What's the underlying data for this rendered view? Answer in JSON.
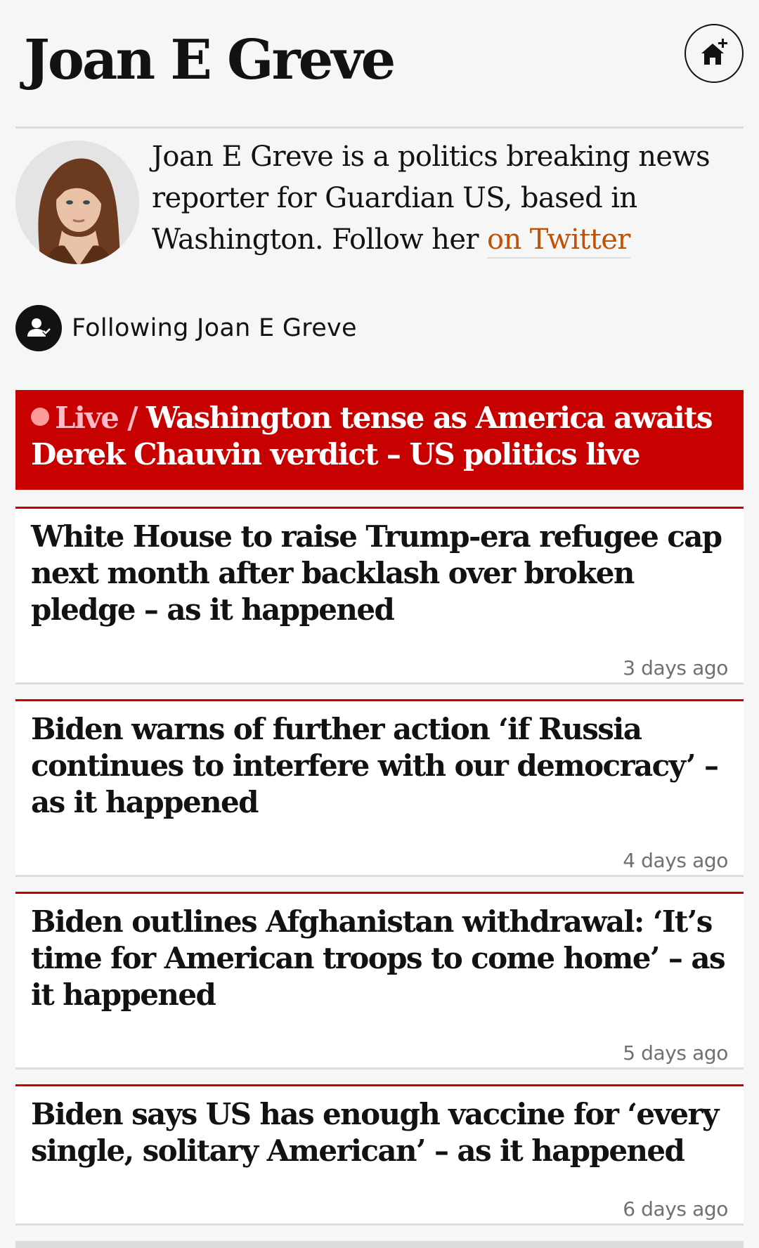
{
  "header": {
    "title": "Joan E Greve",
    "home_icon": "home-plus-icon"
  },
  "profile": {
    "avatar_icon": "avatar",
    "bio_text": "Joan E Greve is a politics breaking news reporter for Guardian US, based in Washington. Follow her ",
    "bio_link": "on Twitter"
  },
  "follow": {
    "icon": "user-following-icon",
    "label": "Following Joan E Greve"
  },
  "live_card": {
    "kicker": "Live",
    "separator": "/",
    "headline": "Washington tense as America awaits Derek Chauvin verdict – US politics live",
    "accent_color": "#c70000"
  },
  "articles": [
    {
      "headline": "White House to raise Trump-era refugee cap next month after backlash over broken pledge – as it happened",
      "age": "3 days ago"
    },
    {
      "headline": "Biden warns of further action ‘if Russia continues to interfere with our democracy’ – as it happened",
      "age": "4 days ago"
    },
    {
      "headline": "Biden outlines Afghanistan withdrawal: ‘It’s time for American troops to come home’ – as it happened",
      "age": "5 days ago"
    },
    {
      "headline": "Biden says US has enough vaccine for ‘every single, solitary American’ – as it happened",
      "age": "6 days ago"
    }
  ],
  "colors": {
    "link": "#c05303",
    "background": "#f6f6f6",
    "text": "#121212"
  }
}
